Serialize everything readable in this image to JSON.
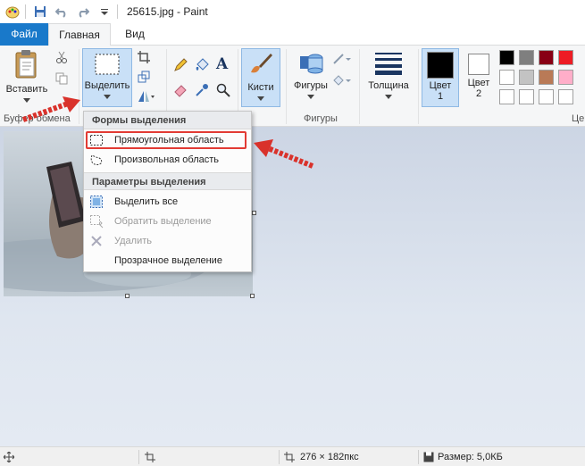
{
  "window": {
    "title": "25615.jpg - Paint"
  },
  "tabs": {
    "file": "Файл",
    "home": "Главная",
    "view": "Вид"
  },
  "ribbon": {
    "clipboard": {
      "paste_label": "Вставить",
      "group_label": "Буфер обмена"
    },
    "image": {
      "select_label": "Выделить"
    },
    "brushes": {
      "label": "Кисти"
    },
    "shapes": {
      "label": "Фигуры",
      "group_label": "Фигуры"
    },
    "size": {
      "label": "Толщина"
    },
    "color1": {
      "line1": "Цвет",
      "line2": "1"
    },
    "color2": {
      "line1": "Цвет",
      "line2": "2"
    },
    "colors_group_label": "Це",
    "palette_row1": [
      "#000000",
      "#7f7f7f",
      "#880015",
      "#ed1c24"
    ],
    "palette_row2": [
      "#ffffff",
      "#c3c3c3",
      "#b97a57",
      "#ffaec9"
    ],
    "palette_row3": [
      "#ffffff",
      "#ffffff",
      "#ffffff",
      "#ffffff"
    ]
  },
  "dropdown": {
    "shapes_header": "Формы выделения",
    "rect": "Прямоугольная область",
    "freeform": "Произвольная область",
    "options_header": "Параметры выделения",
    "select_all": "Выделить все",
    "invert": "Обратить выделение",
    "delete": "Удалить",
    "transparent": "Прозрачное выделение"
  },
  "statusbar": {
    "dimensions": "276 × 182пкс",
    "size": "Размер: 5,0КБ"
  },
  "colors": {
    "accent": "#1979ca",
    "highlight": "#e23b34",
    "selected_btn": "#c9e0f7"
  }
}
